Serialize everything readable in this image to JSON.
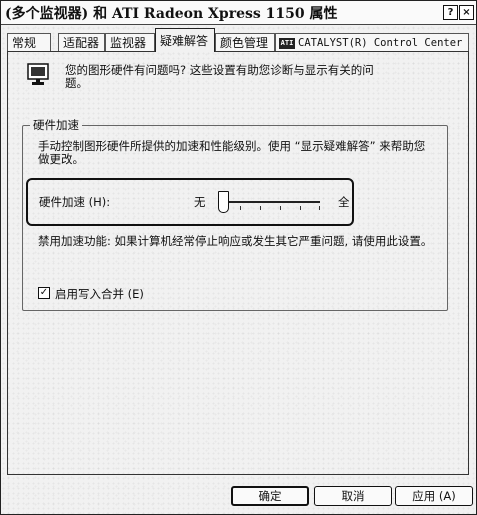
{
  "window": {
    "title": "(多个监视器) 和 ATI Radeon Xpress 1150 属性",
    "help_button": "?",
    "close_button": "×"
  },
  "tabs": [
    {
      "label": "常规"
    },
    {
      "label": "适配器"
    },
    {
      "label": "监视器"
    },
    {
      "label": "疑难解答",
      "active": true
    },
    {
      "label": "颜色管理"
    },
    {
      "label": "CATALYST(R) Control Center",
      "icon": "ati-catalyst-icon",
      "icon_text": "ATI"
    }
  ],
  "intro": {
    "text": "您的图形硬件有问题吗? 这些设置有助您诊断与显示有关的问题。",
    "icon": "monitor-icon"
  },
  "hardware_acceleration": {
    "group_label": "硬件加速",
    "description": "手动控制图形硬件所提供的加速和性能级别。使用 “显示疑难解答” 来帮助您做更改。",
    "slider_label": "硬件加速 (H):",
    "slider_min_label": "无",
    "slider_max_label": "全",
    "slider_position": 0,
    "slider_steps": 6,
    "status_text": "禁用加速功能: 如果计算机经常停止响应或发生其它严重问题, 请使用此设置。"
  },
  "write_combining": {
    "label": "启用写入合并 (E)",
    "checked": true,
    "check_glyph": "✓"
  },
  "buttons": {
    "ok": "确定",
    "cancel": "取消",
    "apply": "应用 (A)"
  }
}
